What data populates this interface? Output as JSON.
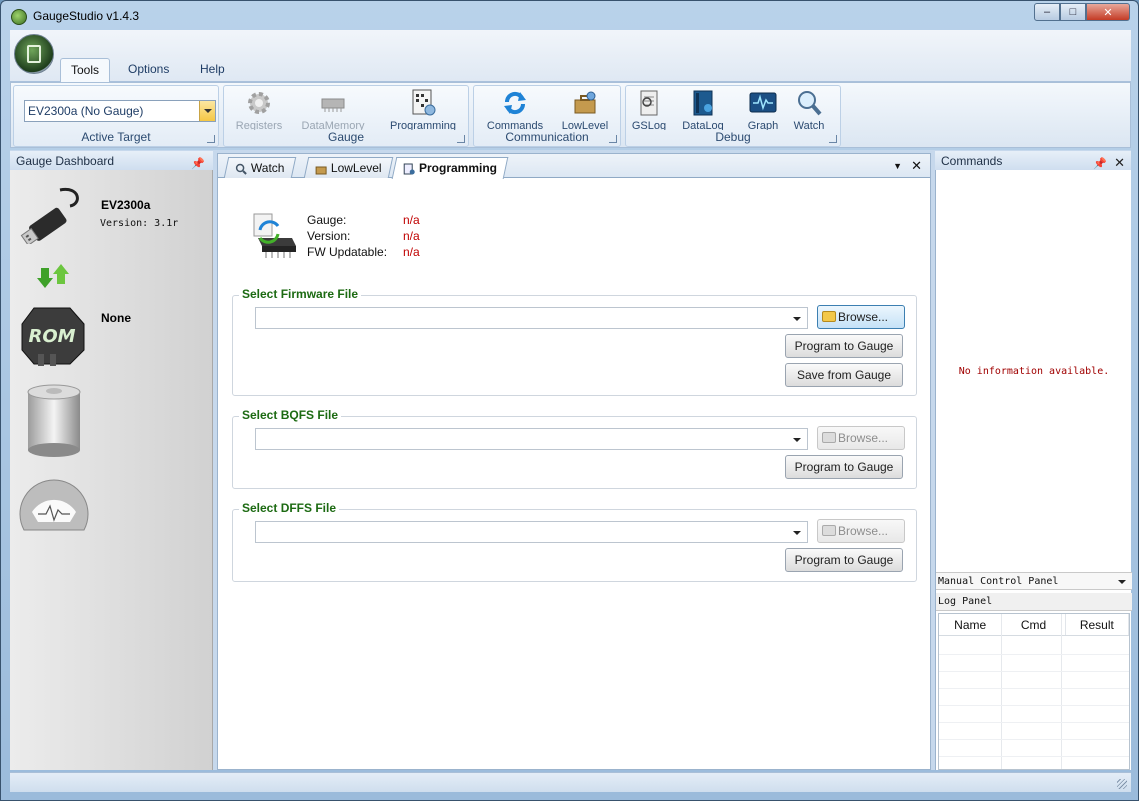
{
  "window": {
    "title": "GaugeStudio v1.4.3"
  },
  "ribbon": {
    "tabs": [
      "Tools",
      "Options",
      "Help"
    ],
    "active_tab": "Tools",
    "groups": {
      "active_target": {
        "label": "Active Target",
        "selected": "EV2300a (No Gauge)"
      },
      "gauge": {
        "label": "Gauge",
        "buttons": [
          "Registers",
          "DataMemory",
          "Programming"
        ]
      },
      "communication": {
        "label": "Communication",
        "buttons": [
          "Commands",
          "LowLevel"
        ]
      },
      "debug": {
        "label": "Debug",
        "buttons": [
          "GSLog",
          "DataLog",
          "Graph",
          "Watch"
        ]
      }
    }
  },
  "dashboard": {
    "title": "Gauge Dashboard",
    "adapter_name": "EV2300a",
    "adapter_version": "Version: 3.1r",
    "gauge_name": "None"
  },
  "documents": {
    "tabs": [
      "Watch",
      "LowLevel",
      "Programming"
    ],
    "active_tab": "Programming",
    "programming": {
      "info": [
        {
          "label": "Gauge:",
          "value": "n/a"
        },
        {
          "label": "Version:",
          "value": "n/a"
        },
        {
          "label": "FW Updatable:",
          "value": "n/a"
        }
      ],
      "firmware": {
        "legend": "Select Firmware File",
        "browse": "Browse...",
        "program": "Program to Gauge",
        "save": "Save from Gauge"
      },
      "bqfs": {
        "legend": "Select BQFS File",
        "browse": "Browse...",
        "program": "Program to Gauge"
      },
      "dffs": {
        "legend": "Select DFFS File",
        "browse": "Browse...",
        "program": "Program to Gauge"
      }
    }
  },
  "commands_panel": {
    "title": "Commands",
    "empty_message": "No information available.",
    "manual_control": "Manual Control Panel",
    "log_panel": "Log Panel",
    "columns": [
      "Name",
      "Cmd",
      "Result"
    ]
  },
  "colors": {
    "legend_green": "#1c6a12",
    "value_red": "#c00000",
    "accent_blue": "#2b4a70"
  }
}
